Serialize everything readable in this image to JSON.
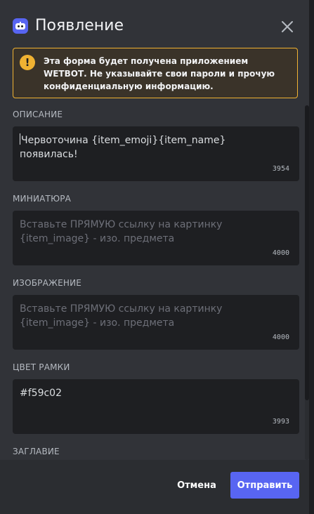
{
  "modal": {
    "title": "Появление",
    "app_icon": "bot-icon",
    "close_icon": "close-icon"
  },
  "warning": {
    "icon": "exclamation-icon",
    "text_before": "Эта форма будет получена приложением ",
    "app_name": "WETBOT",
    "text_after": ". Не указывайте свои пароли и прочую конфиденциальную информацию.",
    "accent_color": "#f0b232"
  },
  "fields": [
    {
      "label": "ОПИСАНИЕ",
      "value": "Червоточина {item_emoji}{item_name} появилась!",
      "placeholder": "",
      "counter": "3954"
    },
    {
      "label": "МИНИАТЮРА",
      "value": "",
      "placeholder": "Вставьте ПРЯМУЮ ссылку на картинку {item_image} - изо. предмета",
      "counter": "4000"
    },
    {
      "label": "ИЗОБРАЖЕНИЕ",
      "value": "",
      "placeholder": "Вставьте ПРЯМУЮ ссылку на картинку {item_image} - изо. предмета",
      "counter": "4000"
    },
    {
      "label": "ЦВЕТ РАМКИ",
      "value": "#f59c02",
      "placeholder": "",
      "counter": "3993"
    }
  ],
  "next_label": "ЗАГЛАВИЕ",
  "footer": {
    "cancel_label": "Отмена",
    "submit_label": "Отправить",
    "submit_color": "#5865f2"
  }
}
